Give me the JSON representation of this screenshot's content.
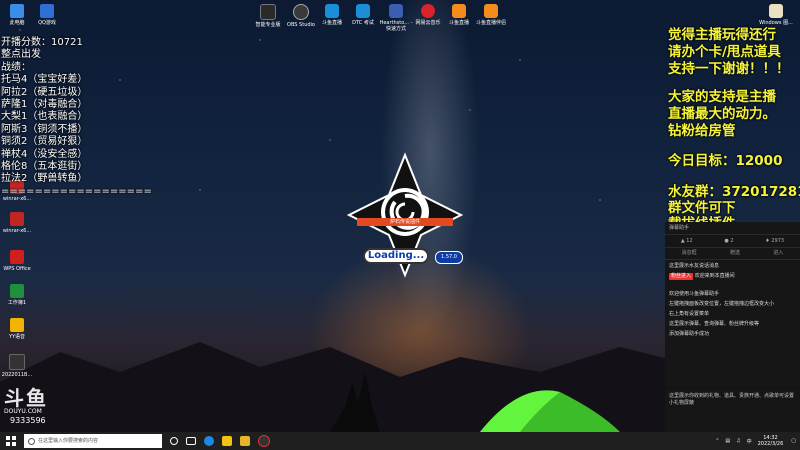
{
  "desktop_icons": [
    {
      "label": "此电脑",
      "color": "#3a8ee6"
    },
    {
      "label": "QQ游戏",
      "color": "#2f6fd6"
    },
    {
      "label": "winrar-x6...",
      "color": "#c02626"
    },
    {
      "label": "winrar-x6...",
      "color": "#c02626"
    },
    {
      "label": "WPS Office",
      "color": "#d11e1e"
    },
    {
      "label": "工作簿1",
      "color": "#1e8f3a"
    },
    {
      "label": "YY语音",
      "color": "#f2b400"
    },
    {
      "label": "2022011B...",
      "color": "#333333"
    }
  ],
  "top_icons": [
    {
      "label": "智能专业版",
      "color": "#2a2a2a"
    },
    {
      "label": "OBS Studio",
      "color": "#3a3a3a"
    },
    {
      "label": "斗鱼直播",
      "color": "#1a8fd8"
    },
    {
      "label": "DTC 考试",
      "color": "#1a8fd8"
    },
    {
      "label": "Hearthsto... - 快速方式",
      "color": "#3a5fb0"
    },
    {
      "label": "网易云音乐",
      "color": "#d8232a"
    },
    {
      "label": "斗鱼直播",
      "color": "#f28c1a"
    },
    {
      "label": "斗鱼直播伴侣",
      "color": "#f28c1a"
    }
  ],
  "windows_icon": {
    "label": "Windows 图..."
  },
  "left_overlay": [
    "开播分数：10721",
    "整点出发",
    "战绩：",
    "托马4（宝宝好差）",
    "阿拉2（硬五垃圾）",
    "萨隆1（对毒融合）",
    "大梨1（也表融合）",
    "阿斯3（铜须不播）",
    "铜须2（贸易好狠）",
    "禅杖4（没安全感）",
    "格伦8（五本逛街）",
    "拉法2（野兽转鱼）",
    "=================="
  ],
  "right_overlay": [
    "觉得主播玩得还行",
    "请办个卡/甩点道具",
    "支持一下谢谢！！！",
    "",
    "大家的支持是主播",
    "直播最大的动力。",
    " 钻粉给房管",
    "",
    " 今日目标：12000",
    "",
    "水友群：372017281",
    "  群文件可下",
    "  载拔线插件"
  ],
  "danmaku_panel": {
    "title": "弹幕助手",
    "stats": [
      "12",
      "2",
      "2973"
    ],
    "tabs": [
      "消息框",
      "赠送",
      "进入"
    ],
    "messages": [
      "这里展示水友说话消息",
      "欢迎来到本直播间",
      "欢迎使用斗鱼弹幕助手",
      "左键拖拽面板改变位置，左键拖拽边框改变大小",
      "右上角有设置菜单",
      "这里展示弹幕、查询弹幕、粉丝牌升级等",
      "添加弹幕助手成功"
    ],
    "system_tag": "粉丝进入",
    "footer": "这里展示你收到的礼物、道具、贵族开通、点歌单可设置小礼物屏蔽"
  },
  "loading": {
    "banner_text": "炉石传说插件",
    "label": "Loading...",
    "version": "1.57.0"
  },
  "watermark": {
    "brand": "斗鱼",
    "site": "DOUYU.COM",
    "room": "9333596"
  },
  "taskbar": {
    "search_placeholder": "在这里输入你要搜索的内容",
    "time": "14:32",
    "date": "2022/3/26",
    "ime": "中"
  }
}
